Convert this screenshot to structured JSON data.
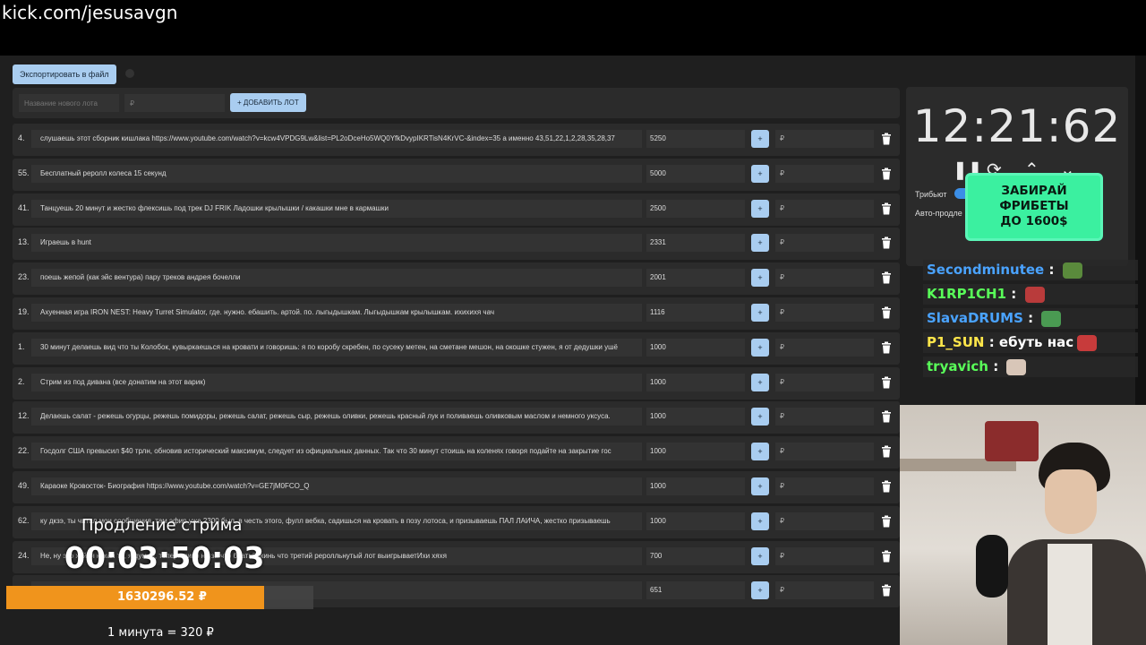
{
  "browser": {
    "url": "kick.com/jesusavgn"
  },
  "toolbar": {
    "export_label": "Экспортировать в файл"
  },
  "new_lot": {
    "name_placeholder": "Название нового лота",
    "price_placeholder": "₽",
    "add_label": "+ ДОБАВИТЬ ЛОТ"
  },
  "lots": [
    {
      "num": "4.",
      "title": "слушаешь этот сборник кишлака https://www.youtube.com/watch?v=kcw4VPDG9Lw&list=PL2oDceHo5WQ0YfkDvypIKRTisN4KrVC-&index=35 а именно 43,51,22,1,2,28,35,28,37",
      "amount": "5250",
      "plus": "+",
      "rub": "₽"
    },
    {
      "num": "55.",
      "title": "Бесплатный реролл колеса 15 секунд",
      "amount": "5000",
      "plus": "+",
      "rub": "₽"
    },
    {
      "num": "41.",
      "title": "Танцуешь 20 минут и жестко флексишь под трек DJ FRIK Ладошки крылышки / какашки мне в кармашки",
      "amount": "2500",
      "plus": "+",
      "rub": "₽"
    },
    {
      "num": "13.",
      "title": "Играешь в hunt",
      "amount": "2331",
      "plus": "+",
      "rub": "₽"
    },
    {
      "num": "23.",
      "title": "поешь жепой (как эйс вентура) пару треков андрея бочелли",
      "amount": "2001",
      "plus": "+",
      "rub": "₽"
    },
    {
      "num": "19.",
      "title": "Ахуенная игра IRON NEST: Heavy Turret Simulator, где. нужно. ебашить. артой. по. лыгыдышкам. Лыгыдышкам крылышкам. ихихихя чач",
      "amount": "1116",
      "plus": "+",
      "rub": "₽"
    },
    {
      "num": "1.",
      "title": "30 минут делаешь вид что ты Колобок, кувыркаешься на кровати и говоришь: я по коробу скребен, по сусеку метен, на сметане мешон, на окошке стужен, я от дедушки ушё",
      "amount": "1000",
      "plus": "+",
      "rub": "₽"
    },
    {
      "num": "2.",
      "title": "Стрим из под дивана (все донатим на этот варик)",
      "amount": "1000",
      "plus": "+",
      "rub": "₽"
    },
    {
      "num": "12.",
      "title": "Делаешь салат - режешь огурцы, режешь помидоры, режешь салат, режешь сыр, режешь оливки, режешь красный лук и поливаешь оливковым маслом и немного уксуса.",
      "amount": "1000",
      "plus": "+",
      "rub": "₽"
    },
    {
      "num": "22.",
      "title": "Госдолг США превысил $40 трлн, обновив исторический максимум, следует из официальных данных. Так что 30 минут стоишь на коленях говоря подайте на закрытие гос",
      "amount": "1000",
      "plus": "+",
      "rub": "₽"
    },
    {
      "num": "49.",
      "title": "Караоке Кровосток- Биография https://www.youtube.com/watch?v=GE7jM0FCO_Q",
      "amount": "1000",
      "plus": "+",
      "rub": "₽"
    },
    {
      "num": "62.",
      "title": "ку дкзэ, ты читал мои сообщения, там эфир уже 2300 был, в честь этого, фулл вебка, садишься на кровать в позу лотоса, и призываешь ПАЛ ЛАИЧА, жестко призываешь",
      "amount": "1000",
      "plus": "+",
      "rub": "₽"
    },
    {
      "num": "24.",
      "title": "Не, ну это хуйня какая то, я думал, теперь пиво не за что братьЗакинь что третий реролльнутый лот выигрываетИхи хяхя",
      "amount": "700",
      "plus": "+",
      "rub": "₽"
    },
    {
      "num": "",
      "title": "",
      "amount": "651",
      "plus": "+",
      "rub": "₽"
    }
  ],
  "timer": {
    "display": "12:21:62",
    "tribute_label": "Трибьют",
    "autoprod_label": "Авто-продле"
  },
  "promo": {
    "line1": "ЗАБИРАЙ",
    "line2": "ФРИБЕТЫ",
    "line3": "ДО 1600$"
  },
  "chat": [
    {
      "user": "Secondminutee",
      "color": "#4aa3ff",
      "text": ""
    },
    {
      "user": "K1RP1CH1",
      "color": "#59ff59",
      "text": ""
    },
    {
      "user": "SlavaDRUMS",
      "color": "#4aa3ff",
      "text": ""
    },
    {
      "user": "P1_SUN",
      "color": "#ffe64a",
      "text": "ебуть нас"
    },
    {
      "user": "tryavich",
      "color": "#59ff59",
      "text": ""
    }
  ],
  "overlay": {
    "label": "Продление стрима",
    "time": "00:03:50:03",
    "total": "1630296.52 ₽",
    "rate": "1 минута = 320 ₽",
    "progress_fraction": 0.84
  },
  "colors": {
    "accent": "#a9cdf0",
    "progress": "#f0941c",
    "promo": "#3bf0a0"
  }
}
